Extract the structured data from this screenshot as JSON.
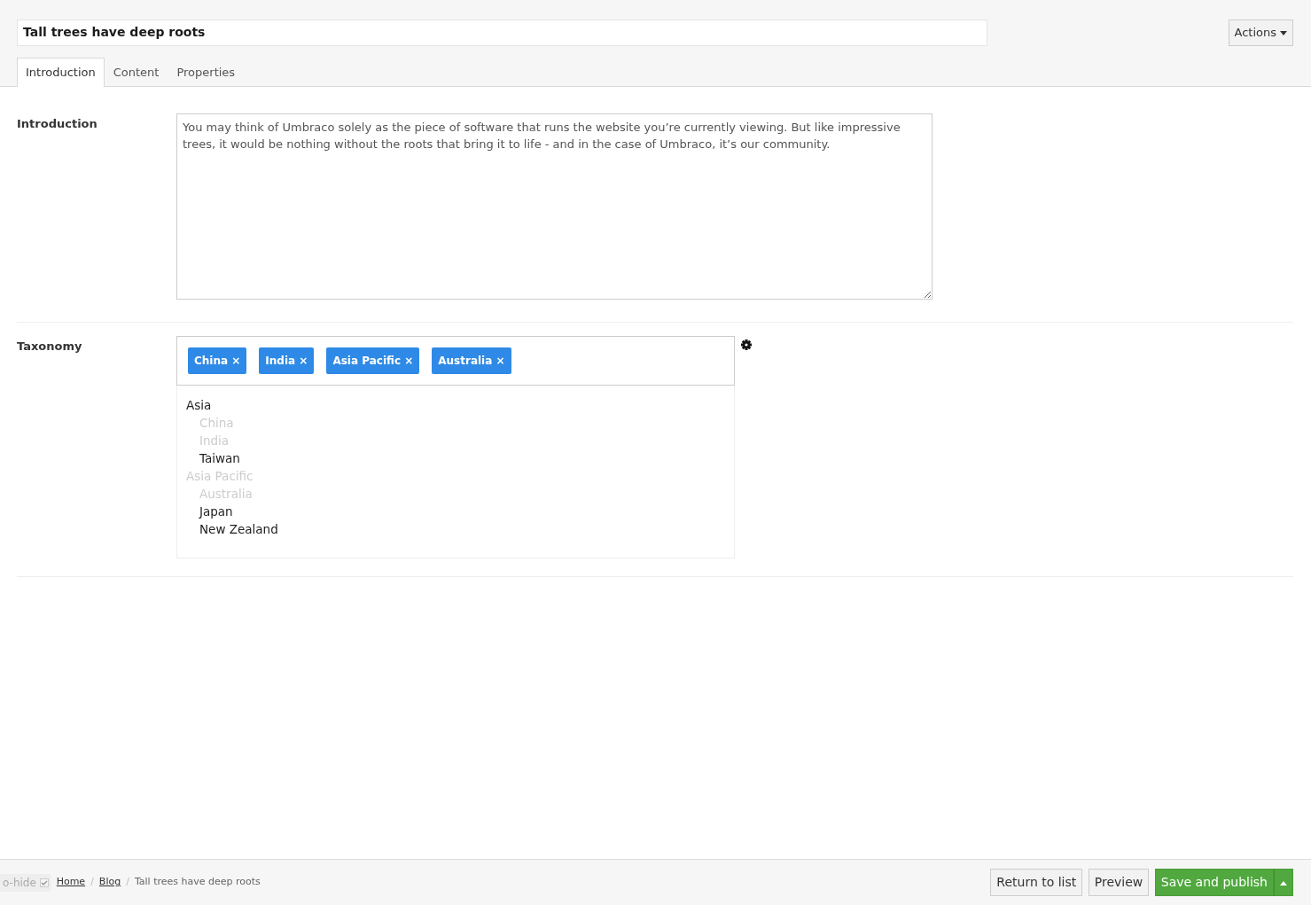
{
  "header": {
    "title": "Tall trees have deep roots",
    "actions_button": "Actions"
  },
  "tabs": [
    {
      "label": "Introduction",
      "selected": true
    },
    {
      "label": "Content",
      "selected": false
    },
    {
      "label": "Properties",
      "selected": false
    }
  ],
  "fields": [
    {
      "kind": "textarea",
      "label": "Introduction",
      "value": "You may think of Umbraco solely as the piece of software that runs the website you’re currently viewing. But like impressive trees, it would be nothing without the roots that bring it to life - and in the case of Umbraco, it’s our community."
    },
    {
      "kind": "taxonomy",
      "label": "Taxonomy",
      "tags": [
        {
          "label": "China",
          "remove": "×"
        },
        {
          "label": "India",
          "remove": "×"
        },
        {
          "label": "Asia Pacific",
          "remove": "×"
        },
        {
          "label": "Australia",
          "remove": "×"
        }
      ],
      "tree": [
        {
          "label": "Asia",
          "disabled": false,
          "children": [
            {
              "label": "China",
              "disabled": true
            },
            {
              "label": "India",
              "disabled": true
            },
            {
              "label": "Taiwan",
              "disabled": false
            }
          ]
        },
        {
          "label": "Asia Pacific",
          "disabled": true,
          "children": [
            {
              "label": "Australia",
              "disabled": true
            },
            {
              "label": "Japan",
              "disabled": false
            },
            {
              "label": "New Zealand",
              "disabled": false
            }
          ]
        }
      ]
    }
  ],
  "footer": {
    "autohide": {
      "label": "o-hide",
      "checked": true
    },
    "breadcrumbs": [
      {
        "label": "Home",
        "link": true
      },
      {
        "separator": "/",
        "label": "Blog",
        "link": true
      },
      {
        "separator": "/",
        "label": "Tall trees have deep roots",
        "link": false
      }
    ],
    "buttons": [
      {
        "label": "Return to list",
        "kind": "default"
      },
      {
        "label": "Preview",
        "kind": "default"
      },
      {
        "label": "Save and publish",
        "kind": "success"
      }
    ]
  }
}
